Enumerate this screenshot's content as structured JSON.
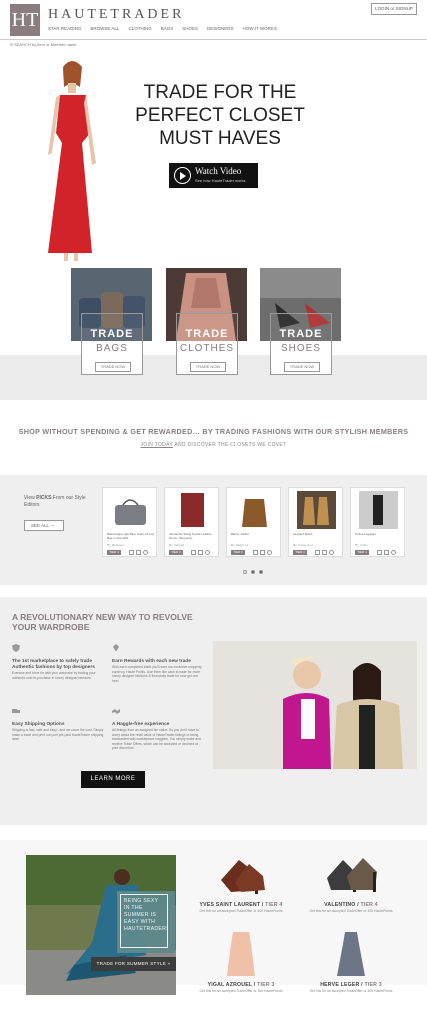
{
  "header": {
    "logo_mark": "HT",
    "brand": "HAUTETRADER",
    "login_label": "LOGIN or SIGNUP",
    "nav": [
      "STAR READING",
      "BROWSE ALL",
      "CLOTHING",
      "BAGS",
      "SHOES",
      "DESIGNERS",
      "HOW IT WORKS"
    ],
    "search_placeholder": "SEARCH by Item or Member name"
  },
  "hero": {
    "headline": "TRADE FOR THE PERFECT CLOSET MUST HAVES",
    "watch_title": "Watch Video",
    "watch_sub": "See how HauteTrader works"
  },
  "categories": [
    {
      "trade": "TRADE",
      "name": "BAGS",
      "button": "TRADE NOW"
    },
    {
      "trade": "TRADE",
      "name": "CLOTHES",
      "button": "TRADE NOW"
    },
    {
      "trade": "TRADE",
      "name": "SHOES",
      "button": "TRADE NOW"
    }
  ],
  "promo": {
    "title": "SHOP WITHOUT SPENDING & GET REWARDED… BY TRADING FASHIONS WITH OUR STYLISH MEMBERS",
    "join": "JOIN TODAY",
    "sub_rest": " AND DISCOVER THE CLOSETS WE COVET"
  },
  "picks": {
    "label_pre": "View ",
    "label_bold": "PICKS",
    "label_post": " From our Style Editors",
    "see_all": "SEE ALL",
    "items": [
      {
        "name": "Balenciaga Light Blue Giant 21 City Bag in Gris M#1",
        "member": "By: Bettyrem",
        "tier": "TIER 4"
      },
      {
        "name": "Alexander Wang Suede Leather Dress - Burgundy",
        "member": "By: Vannah",
        "tier": "TIER 3"
      },
      {
        "name": "Blazer Jacket",
        "member": "By: Ralph La",
        "tier": "TIER 3"
      },
      {
        "name": "Leopard Boots",
        "member": "By: Chavonnet",
        "tier": "TIER 4"
      },
      {
        "name": "Celine Luggage",
        "member": "By: Collin",
        "tier": "TIER 4"
      }
    ]
  },
  "revolution": {
    "title": "A REVOLUTIONARY NEW WAY TO REVOLVE YOUR WARDROBE",
    "features": [
      {
        "title": "The 1st marketplace to safely trade Authentic fashions by top designers",
        "text": "Exercise and hone for with your wardrobe by trading your authentic cold-to-purchase in luxury designer fashions."
      },
      {
        "title": "Earn Rewards with each new trade",
        "text": "With each completed trade you'll earn our exclusive shopping currency, Haute Points. Use them like cash to trade for more luxury designer fashions & financially trade for new get one free!"
      },
      {
        "title": "Easy Shipping Options",
        "text": "Shipping is fast, safe and easy - and we cover the cost. Simply make a trade and print out your pre-paid HauteTrader shipping label."
      },
      {
        "title": "A Haggle-free experience",
        "text": "All listings from an assigned tier value. So you don't have to worry about the retail value of HauteTrader listings or being bombarded with marketplace hagglers. You simply make and receive Trade Offers, which can be accepted or declined at your discretion."
      }
    ],
    "learn_more": "LEARN MORE"
  },
  "summer": {
    "text": "BEING SEXY IN THE SUMMER IS EASY WITH HAUTETRADER!",
    "button": "TRADE FOR SUMMER STYLE »"
  },
  "shoes": [
    {
      "designer": "YVES SAINT LAURENT",
      "tier": "TIER 4",
      "sub": "Get this for an accepted TradeOffer or 400 HautePoints"
    },
    {
      "designer": "VALENTINO",
      "tier": "TIER 4",
      "sub": "Get this for an accepted TradeOffer or 400 HautePoints"
    },
    {
      "designer": "YIGAL AZROUEL",
      "tier": "TIER 3",
      "sub": "Get this for an accepted TradeOffer or 300 HautePoints"
    },
    {
      "designer": "HERVE LEGER",
      "tier": "TIER 3",
      "sub": "Get this for an accepted TradeOffer or 300 HautePoints"
    }
  ]
}
